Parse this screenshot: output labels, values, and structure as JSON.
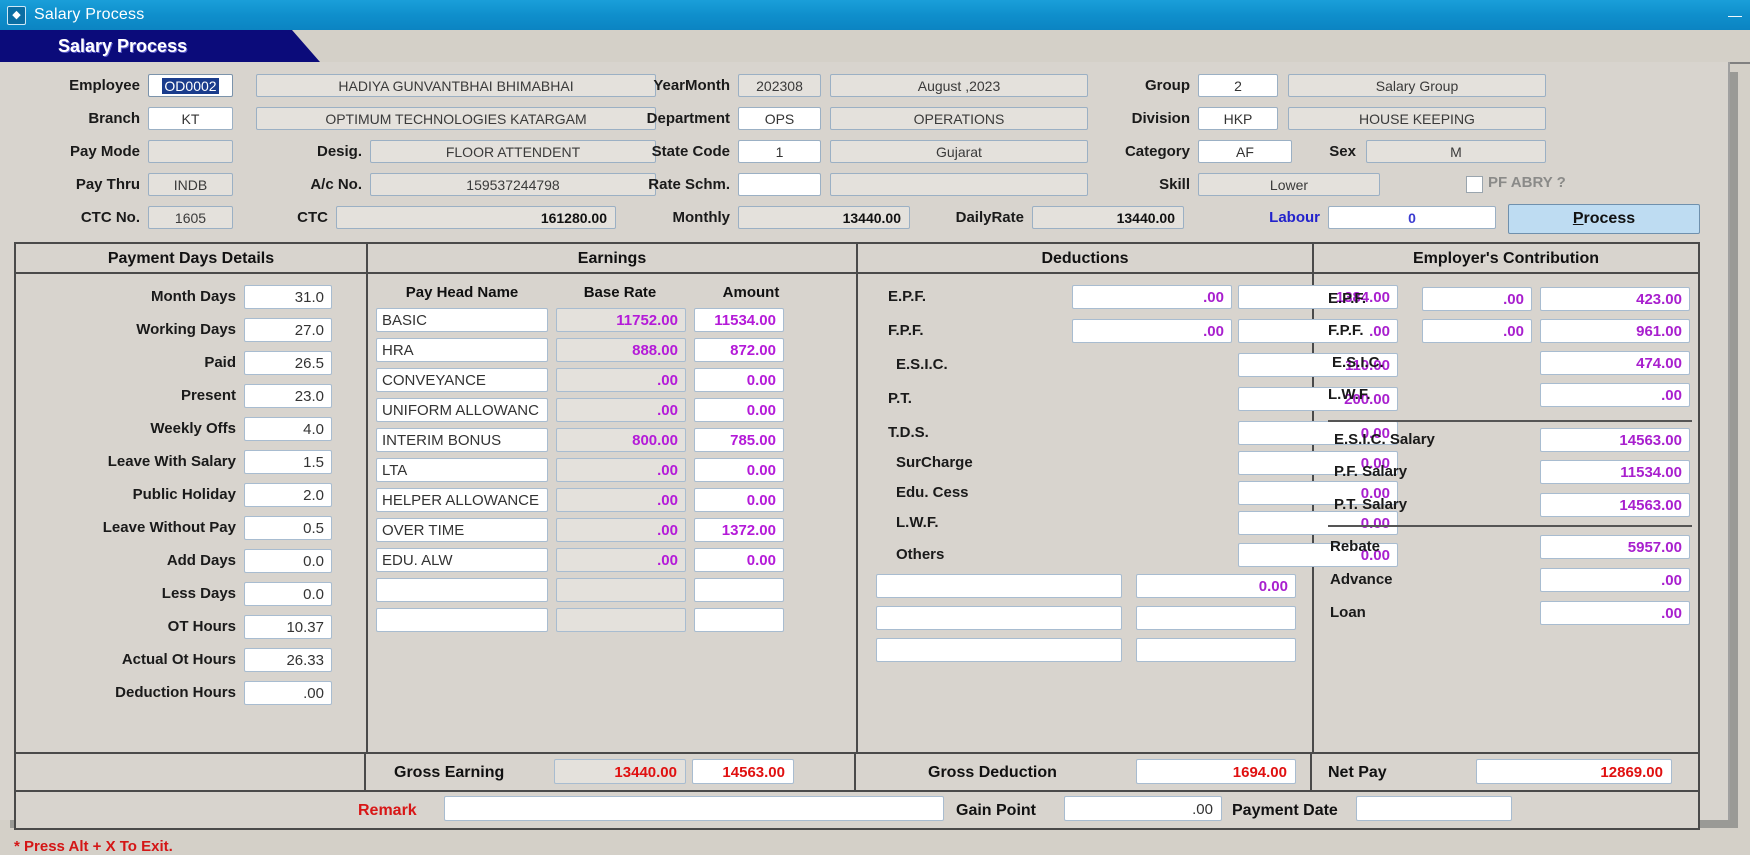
{
  "window": {
    "title": "Salary Process",
    "icon": "app-icon",
    "minimize": "—"
  },
  "tab": {
    "label": "Salary Process"
  },
  "header": {
    "employee_label": "Employee",
    "employee_code": "OD0002",
    "employee_name": "HADIYA GUNVANTBHAI BHIMABHAI",
    "branch_label": "Branch",
    "branch_code": "KT",
    "branch_name": "OPTIMUM  TECHNOLOGIES KATARGAM",
    "paymode_label": "Pay Mode",
    "paymode_value": "",
    "desig_label": "Desig.",
    "desig_value": "FLOOR ATTENDENT",
    "paythru_label": "Pay Thru",
    "paythru_value": "INDB",
    "acno_label": "A/c No.",
    "acno_value": "159537244798",
    "ctcno_label": "CTC No.",
    "ctcno_value": "1605",
    "ctc_label": "CTC",
    "ctc_value": "161280.00",
    "yearmonth_label": "YearMonth",
    "yearmonth_code": "202308",
    "yearmonth_name": "August   ,2023",
    "department_label": "Department",
    "department_code": "OPS",
    "department_name": "OPERATIONS",
    "statecode_label": "State Code",
    "statecode_code": "1",
    "statecode_name": "Gujarat",
    "rateschm_label": "Rate Schm.",
    "rateschm_code": "",
    "rateschm_name": "",
    "monthly_label": "Monthly",
    "monthly_value": "13440.00",
    "group_label": "Group",
    "group_code": "2",
    "group_name": "Salary Group",
    "division_label": "Division",
    "division_code": "HKP",
    "division_name": "HOUSE KEEPING",
    "category_label": "Category",
    "category_code": "AF",
    "sex_label": "Sex",
    "sex_value": "M",
    "skill_label": "Skill",
    "skill_value": "Lower",
    "pfabry_label": "PF ABRY ?",
    "dailyrate_label": "DailyRate",
    "dailyrate_value": "13440.00",
    "labour_label": "Labour",
    "labour_value": "0",
    "process_label": "Process",
    "process_accel": "P"
  },
  "payment_days": {
    "title": "Payment Days Details",
    "rows": [
      {
        "label": "Month Days",
        "value": "31.0"
      },
      {
        "label": "Working Days",
        "value": "27.0"
      },
      {
        "label": "Paid",
        "value": "26.5"
      },
      {
        "label": "Present",
        "value": "23.0"
      },
      {
        "label": "Weekly Offs",
        "value": "4.0"
      },
      {
        "label": "Leave With Salary",
        "value": "1.5"
      },
      {
        "label": "Public Holiday",
        "value": "2.0"
      },
      {
        "label": "Leave Without Pay",
        "value": "0.5"
      },
      {
        "label": "Add Days",
        "value": "0.0"
      },
      {
        "label": "Less Days",
        "value": "0.0"
      },
      {
        "label": "OT Hours",
        "value": "10.37"
      },
      {
        "label": "Actual Ot Hours",
        "value": "26.33"
      },
      {
        "label": "Deduction Hours",
        "value": ".00"
      }
    ]
  },
  "earnings": {
    "title": "Earnings",
    "col_name": "Pay Head Name",
    "col_base": "Base Rate",
    "col_amount": "Amount",
    "rows": [
      {
        "name": "BASIC",
        "base": "11752.00",
        "amount": "11534.00"
      },
      {
        "name": "HRA",
        "base": "888.00",
        "amount": "872.00"
      },
      {
        "name": "CONVEYANCE",
        "base": ".00",
        "amount": "0.00"
      },
      {
        "name": "UNIFORM ALLOWANC",
        "base": ".00",
        "amount": "0.00"
      },
      {
        "name": "INTERIM BONUS",
        "base": "800.00",
        "amount": "785.00"
      },
      {
        "name": "LTA",
        "base": ".00",
        "amount": "0.00"
      },
      {
        "name": "HELPER ALLOWANCE",
        "base": ".00",
        "amount": "0.00"
      },
      {
        "name": "OVER TIME",
        "base": ".00",
        "amount": "1372.00"
      },
      {
        "name": "EDU. ALW",
        "base": ".00",
        "amount": "0.00"
      },
      {
        "name": "",
        "base": "",
        "amount": ""
      },
      {
        "name": "",
        "base": "",
        "amount": ""
      }
    ]
  },
  "deductions": {
    "title": "Deductions",
    "rows": [
      {
        "label": "E.P.F.",
        "left": ".00",
        "right": "1384.00",
        "has_left": true
      },
      {
        "label": "F.P.F.",
        "left": ".00",
        "right": ".00",
        "has_left": true
      },
      {
        "label": "E.S.I.C.",
        "left": "",
        "right": "110.00",
        "has_left": false
      },
      {
        "label": "P.T.",
        "left": "",
        "right": "200.00",
        "has_left": false
      },
      {
        "label": "T.D.S.",
        "left": "",
        "right": "0.00",
        "has_left": false
      },
      {
        "label": "SurCharge",
        "left": "",
        "right": "0.00",
        "has_left": false
      },
      {
        "label": "Edu. Cess",
        "left": "",
        "right": "0.00",
        "has_left": false
      },
      {
        "label": "L.W.F.",
        "left": "",
        "right": "0.00",
        "has_left": false
      },
      {
        "label": "Others",
        "left": "",
        "right": "0.00",
        "has_left": false
      },
      {
        "label": "",
        "left": "",
        "right": "0.00",
        "has_left": true
      },
      {
        "label": "",
        "left": "",
        "right": "",
        "has_left": true
      },
      {
        "label": "",
        "left": "",
        "right": "",
        "has_left": true
      }
    ]
  },
  "employer": {
    "title": "Employer's Contribution",
    "rows": [
      {
        "label": "E.P.F.",
        "left": ".00",
        "right": "423.00",
        "has_left": true
      },
      {
        "label": "F.P.F.",
        "left": ".00",
        "right": "961.00",
        "has_left": true
      },
      {
        "label": "E.S.I.C.",
        "left": "",
        "right": "474.00",
        "has_left": false
      },
      {
        "label": "L.W.F.",
        "left": "",
        "right": ".00",
        "has_left": false
      }
    ],
    "salary_rows": [
      {
        "label": "E.S.I.C. Salary",
        "value": "14563.00"
      },
      {
        "label": "P.F. Salary",
        "value": "11534.00"
      },
      {
        "label": "P.T. Salary",
        "value": "14563.00"
      }
    ],
    "other_rows": [
      {
        "label": "Rebate",
        "value": "5957.00"
      },
      {
        "label": "Advance",
        "value": ".00"
      },
      {
        "label": "Loan",
        "value": ".00"
      }
    ]
  },
  "totals": {
    "gross_earning_label": "Gross Earning",
    "gross_earning_base": "13440.00",
    "gross_earning_amount": "14563.00",
    "gross_deduction_label": "Gross Deduction",
    "gross_deduction_value": "1694.00",
    "net_pay_label": "Net Pay",
    "net_pay_value": "12869.00"
  },
  "remark": {
    "label": "Remark",
    "value": "",
    "gain_point_label": "Gain Point",
    "gain_point_value": ".00",
    "payment_date_label": "Payment Date",
    "payment_date_value": ""
  },
  "footer": {
    "hint": "* Press Alt + X To Exit."
  }
}
